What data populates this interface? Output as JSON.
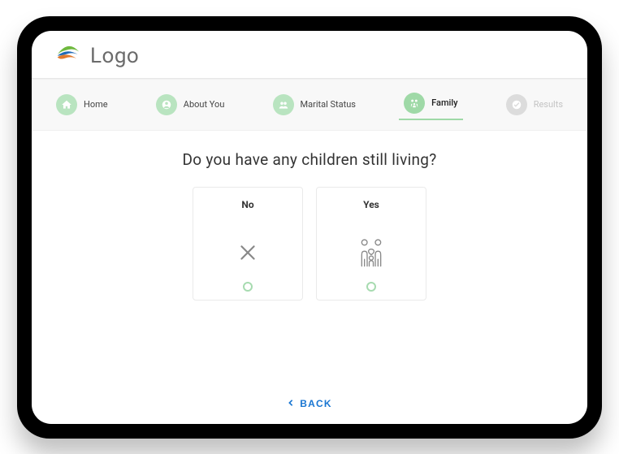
{
  "header": {
    "logo_text": "Logo"
  },
  "steps": [
    {
      "label": "Home",
      "state": "done",
      "icon": "home-icon"
    },
    {
      "label": "About You",
      "state": "done",
      "icon": "person-icon"
    },
    {
      "label": "Marital Status",
      "state": "done",
      "icon": "couple-icon"
    },
    {
      "label": "Family",
      "state": "active",
      "icon": "family-icon"
    },
    {
      "label": "Results",
      "state": "disabled",
      "icon": "check-icon"
    }
  ],
  "question": "Do you have any children still living?",
  "options": {
    "no": {
      "label": "No"
    },
    "yes": {
      "label": "Yes"
    }
  },
  "footer": {
    "back_label": "BACK"
  },
  "colors": {
    "step_done": "#b9e4c0",
    "step_active": "#9fd9a7",
    "accent": "#1976d2"
  }
}
